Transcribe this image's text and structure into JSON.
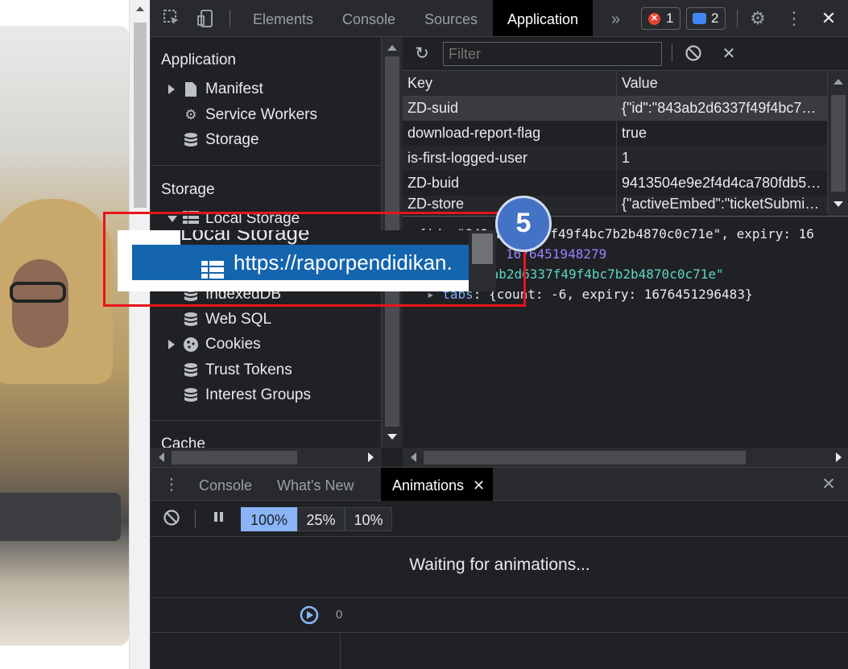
{
  "devtools": {
    "tabs": [
      "Elements",
      "Console",
      "Sources",
      "Application"
    ],
    "active_tab": "Application",
    "more_tabs_glyph": "»",
    "error_count": "1",
    "message_count": "2",
    "colors": {
      "background": "#202124",
      "active_tab": "#000000",
      "accent": "#8ab4f8",
      "error": "#e94235"
    }
  },
  "sidebar": {
    "application_title": "Application",
    "application_items": [
      "Manifest",
      "Service Workers",
      "Storage"
    ],
    "storage_title": "Storage",
    "storage_items": [
      "Local Storage",
      "IndexedDB",
      "Web SQL",
      "Cookies",
      "Trust Tokens",
      "Interest Groups"
    ],
    "cache_title": "Cache"
  },
  "main": {
    "filter_placeholder": "Filter",
    "columns": [
      "Key",
      "Value"
    ],
    "rows": [
      {
        "key": "ZD-suid",
        "value": "{\"id\":\"843ab2d6337f49f4bc7…"
      },
      {
        "key": "download-report-flag",
        "value": "true"
      },
      {
        "key": "is-first-logged-user",
        "value": "1"
      },
      {
        "key": "ZD-buid",
        "value": "9413504e9e2f4d4ca780fdb5…"
      },
      {
        "key": "ZD-store",
        "value": "{\"activeEmbed\":\"ticketSubmi…"
      }
    ],
    "preview": {
      "line1": "▾{id: \"843ab2d6337f49f4bc7b2b4870c0c71e\", expiry: 16",
      "line2_num": "1676451948279",
      "line3_str": "3ab2d6337f49f4bc7b2b4870c0c71e\"",
      "line4_prop": "tabs",
      "line4_rest": ": {count: -6, expiry: 1676451296483}"
    }
  },
  "drawer": {
    "tabs": [
      "Console",
      "What's New",
      "Animations"
    ],
    "active_tab": "Animations",
    "speeds": [
      "100%",
      "25%",
      "10%"
    ],
    "active_speed": "100%",
    "waiting_text": "Waiting for animations...",
    "timeline_zero": "0"
  },
  "annotation": {
    "step_number": "5",
    "highlight_url": "https://raporpendidikan.",
    "highlight_color": "#e8141b",
    "step_color": "#4472c4"
  }
}
